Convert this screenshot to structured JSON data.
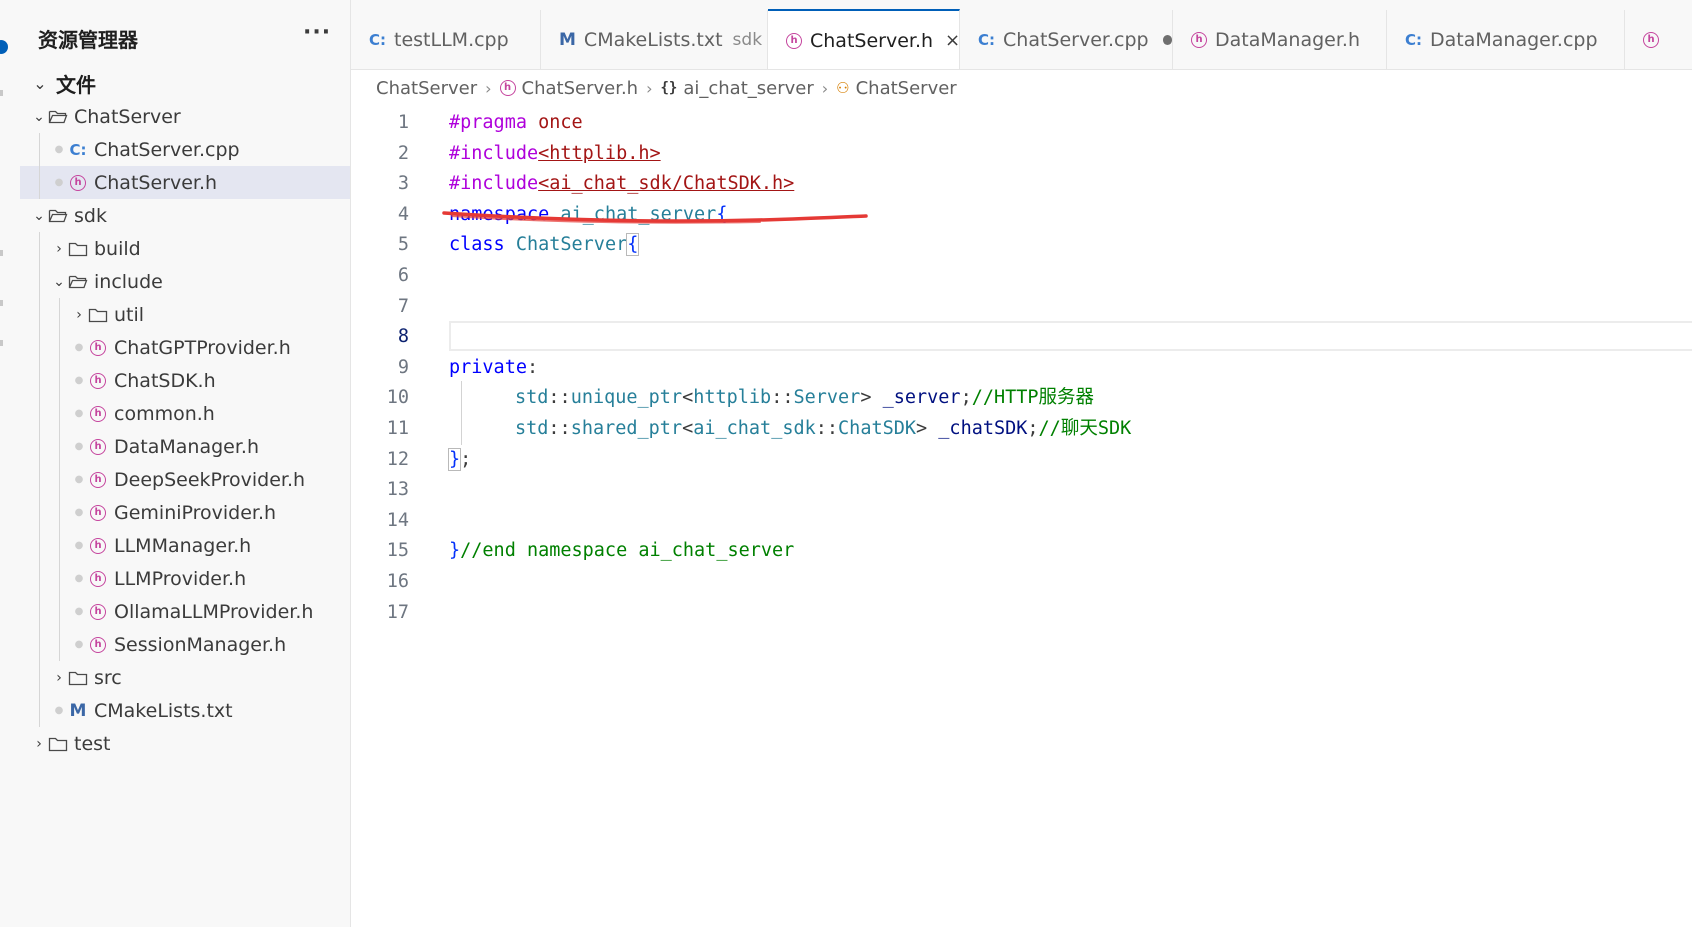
{
  "sidebar": {
    "title": "资源管理器",
    "more_label": "···",
    "section_label": "文件",
    "items": [
      {
        "label": "ChatServer",
        "kind": "folder",
        "expanded": true,
        "depth": 0
      },
      {
        "label": "ChatServer.cpp",
        "kind": "cpp",
        "depth": 1
      },
      {
        "label": "ChatServer.h",
        "kind": "h",
        "depth": 1,
        "selected": true
      },
      {
        "label": "sdk",
        "kind": "folder",
        "expanded": true,
        "depth": 0
      },
      {
        "label": "build",
        "kind": "folder",
        "expanded": false,
        "depth": 1
      },
      {
        "label": "include",
        "kind": "folder",
        "expanded": true,
        "depth": 1
      },
      {
        "label": "util",
        "kind": "folder",
        "expanded": false,
        "depth": 2
      },
      {
        "label": "ChatGPTProvider.h",
        "kind": "h",
        "depth": 2
      },
      {
        "label": "ChatSDK.h",
        "kind": "h",
        "depth": 2
      },
      {
        "label": "common.h",
        "kind": "h",
        "depth": 2
      },
      {
        "label": "DataManager.h",
        "kind": "h",
        "depth": 2
      },
      {
        "label": "DeepSeekProvider.h",
        "kind": "h",
        "depth": 2
      },
      {
        "label": "GeminiProvider.h",
        "kind": "h",
        "depth": 2
      },
      {
        "label": "LLMManager.h",
        "kind": "h",
        "depth": 2
      },
      {
        "label": "LLMProvider.h",
        "kind": "h",
        "depth": 2
      },
      {
        "label": "OllamaLLMProvider.h",
        "kind": "h",
        "depth": 2
      },
      {
        "label": "SessionManager.h",
        "kind": "h",
        "depth": 2
      },
      {
        "label": "src",
        "kind": "folder",
        "expanded": false,
        "depth": 1
      },
      {
        "label": "CMakeLists.txt",
        "kind": "cmake",
        "depth": 1
      },
      {
        "label": "test",
        "kind": "folder",
        "expanded": false,
        "depth": 0
      }
    ]
  },
  "tabs": [
    {
      "label": "testLLM.cpp",
      "kind": "cpp"
    },
    {
      "label": "CMakeLists.txt",
      "kind": "cmake",
      "description": "sdk"
    },
    {
      "label": "ChatServer.h",
      "kind": "h",
      "active": true,
      "close": "×"
    },
    {
      "label": "ChatServer.cpp",
      "kind": "cpp",
      "modified": true
    },
    {
      "label": "DataManager.h",
      "kind": "h"
    },
    {
      "label": "DataManager.cpp",
      "kind": "cpp"
    }
  ],
  "breadcrumb": {
    "items": [
      "ChatServer",
      "ChatServer.h",
      "ai_chat_server",
      "ChatServer"
    ]
  },
  "editor": {
    "current_line": 8,
    "lines": [
      {
        "n": "1",
        "tokens": [
          [
            "pp",
            "#pragma"
          ],
          [
            "pn",
            " "
          ],
          [
            "str-nu",
            "once"
          ]
        ]
      },
      {
        "n": "2",
        "tokens": [
          [
            "pp",
            "#include"
          ],
          [
            "str",
            "<httplib.h>"
          ]
        ]
      },
      {
        "n": "3",
        "tokens": [
          [
            "pp",
            "#include"
          ],
          [
            "str",
            "<ai_chat_sdk/ChatSDK.h>"
          ]
        ]
      },
      {
        "n": "4",
        "tokens": [
          [
            "kw",
            "namespace"
          ],
          [
            "pn",
            " "
          ],
          [
            "ns",
            "ai_chat_server"
          ],
          [
            "br",
            "{"
          ]
        ]
      },
      {
        "n": "5",
        "tokens": [
          [
            "kw",
            "class"
          ],
          [
            "pn",
            " "
          ],
          [
            "type",
            "ChatServer"
          ],
          [
            "brm",
            "{"
          ]
        ]
      },
      {
        "n": "6",
        "tokens": []
      },
      {
        "n": "7",
        "tokens": []
      },
      {
        "n": "8",
        "tokens": []
      },
      {
        "n": "9",
        "tokens": [
          [
            "kw",
            "private"
          ],
          [
            "pn",
            ":"
          ]
        ]
      },
      {
        "n": "10",
        "indent": true,
        "tokens": [
          [
            "ns",
            "std"
          ],
          [
            "pn",
            "::"
          ],
          [
            "type",
            "unique_ptr"
          ],
          [
            "pn",
            "<"
          ],
          [
            "ns",
            "httplib"
          ],
          [
            "pn",
            "::"
          ],
          [
            "type",
            "Server"
          ],
          [
            "pn",
            "> "
          ],
          [
            "id",
            "_server"
          ],
          [
            "pn",
            ";"
          ],
          [
            "cm",
            "//HTTP服务器"
          ]
        ]
      },
      {
        "n": "11",
        "indent": true,
        "tokens": [
          [
            "ns",
            "std"
          ],
          [
            "pn",
            "::"
          ],
          [
            "type",
            "shared_ptr"
          ],
          [
            "pn",
            "<"
          ],
          [
            "ns",
            "ai_chat_sdk"
          ],
          [
            "pn",
            "::"
          ],
          [
            "type",
            "ChatSDK"
          ],
          [
            "pn",
            "> "
          ],
          [
            "id",
            "_chatSDK"
          ],
          [
            "pn",
            ";"
          ],
          [
            "cm",
            "//聊天SDK"
          ]
        ]
      },
      {
        "n": "12",
        "tokens": [
          [
            "brm",
            "}"
          ],
          [
            "pn",
            ";"
          ]
        ]
      },
      {
        "n": "13",
        "tokens": []
      },
      {
        "n": "14",
        "tokens": []
      },
      {
        "n": "15",
        "tokens": [
          [
            "br",
            "}"
          ],
          [
            "cm",
            "//end namespace ai_chat_server"
          ]
        ]
      },
      {
        "n": "16",
        "tokens": []
      },
      {
        "n": "17",
        "tokens": []
      }
    ]
  },
  "colors": {
    "accent": "#005fb8",
    "annotation_stroke": "#e53935",
    "header_icon": "#c5459e",
    "cpp_icon": "#3c7fd1"
  }
}
